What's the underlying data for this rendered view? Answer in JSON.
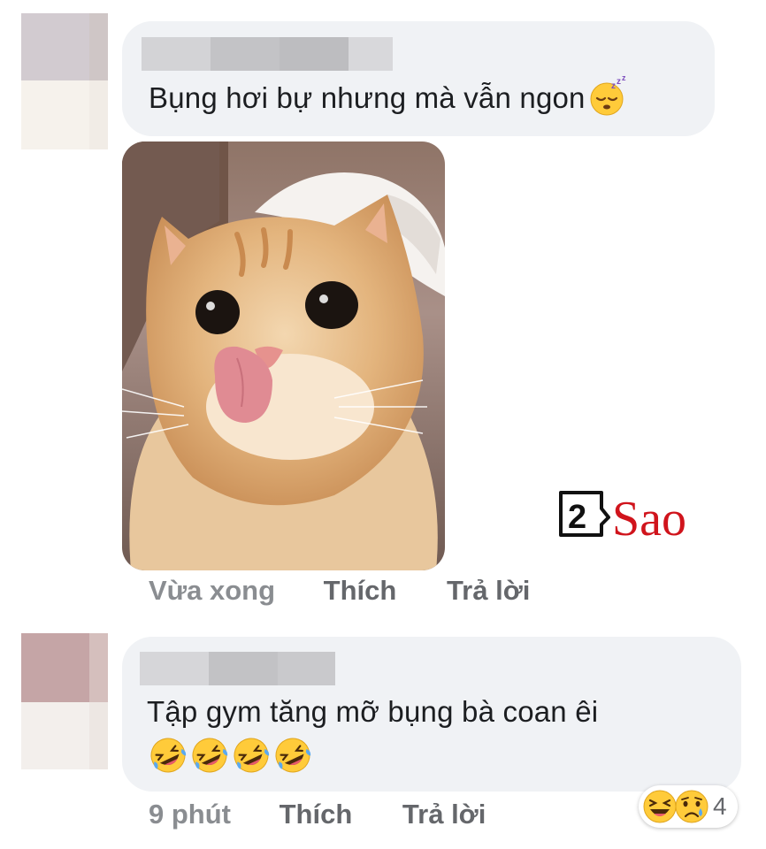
{
  "comments": [
    {
      "text": "Bụng hơi bự nhưng mà vẫn ngon",
      "emoji": "sleepy-zzz-emoji",
      "actions": {
        "time": "Vừa xong",
        "like": "Thích",
        "reply": "Trả lời"
      }
    },
    {
      "text": "Tập gym tăng mỡ bụng bà coan êi",
      "emoji_row": [
        "rofl-emoji",
        "rofl-emoji",
        "rofl-emoji",
        "rofl-emoji"
      ],
      "actions": {
        "time": "9 phút",
        "like": "Thích",
        "reply": "Trả lời"
      },
      "reactions": {
        "icons": [
          "laughing-emoji",
          "sad-tear-emoji"
        ],
        "count": "4"
      }
    }
  ],
  "watermark": {
    "digit": "2",
    "word": "Sao"
  },
  "colors": {
    "bubble": "#f0f2f5",
    "text": "#1c1e21",
    "action": "#65676b",
    "logo_red": "#d0141c"
  }
}
